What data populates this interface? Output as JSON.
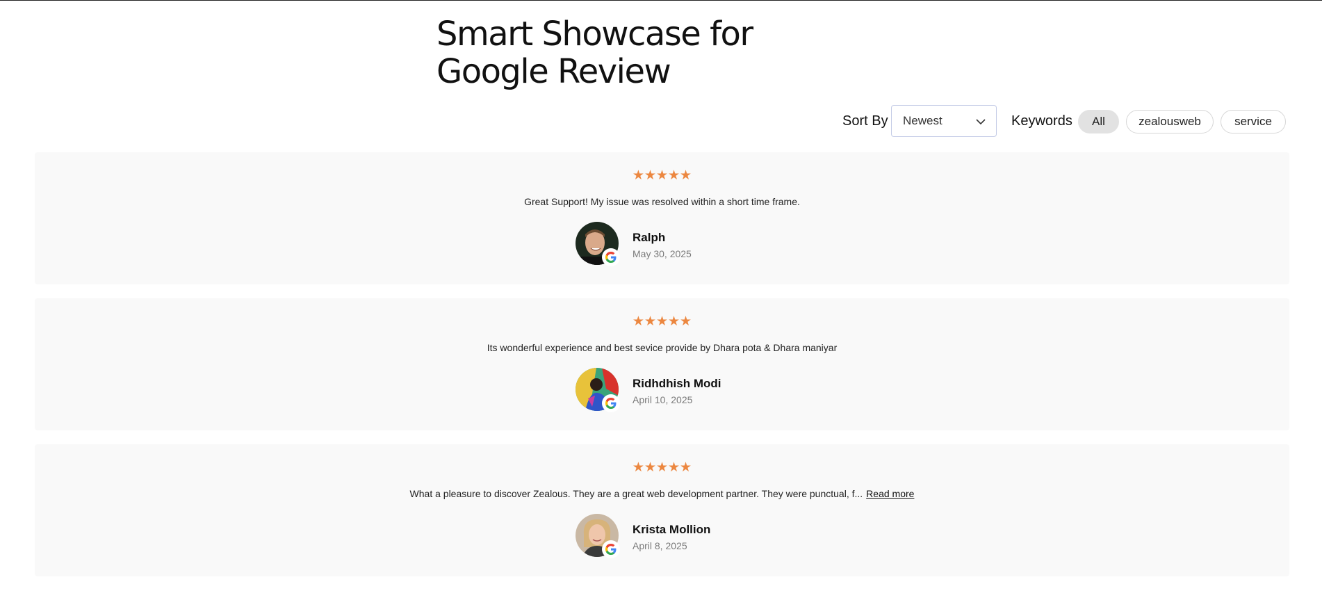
{
  "page": {
    "title_line1": "Smart Showcase for",
    "title_line2": "Google Review"
  },
  "filters": {
    "sort_label": "Sort By",
    "sort_value": "Newest",
    "keywords_label": "Keywords",
    "keywords": [
      {
        "label": "All",
        "active": true
      },
      {
        "label": "zealousweb",
        "active": false
      },
      {
        "label": "service",
        "active": false
      }
    ]
  },
  "colors": {
    "star": "#ec8740",
    "card_bg": "#f9f9f9"
  },
  "reviews": [
    {
      "stars": "★★★★★",
      "rating": 5,
      "text": "Great Support! My issue was resolved within a short time frame.",
      "name": "Ralph",
      "date": "May 30, 2025",
      "avatar_icon": "avatar-photo",
      "badge_icon": "google-g-icon"
    },
    {
      "stars": "★★★★★",
      "rating": 5,
      "text": "Its wonderful experience and best sevice provide by Dhara pota & Dhara maniyar",
      "name": "Ridhdhish Modi",
      "date": "April 10, 2025",
      "avatar_icon": "avatar-photo",
      "badge_icon": "google-g-icon"
    },
    {
      "stars": "★★★★★",
      "rating": 5,
      "text": "What a pleasure to discover Zealous. They are a great web development partner. They were punctual, f...",
      "read_more": "Read more",
      "name": "Krista Mollion",
      "date": "April 8, 2025",
      "avatar_icon": "avatar-photo",
      "badge_icon": "google-g-icon"
    }
  ]
}
